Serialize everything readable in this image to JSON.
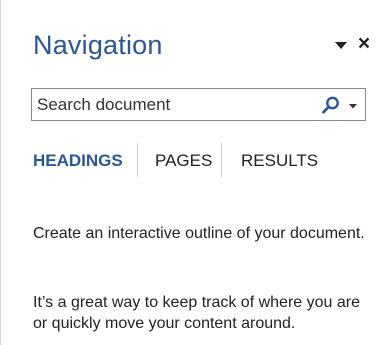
{
  "pane": {
    "title": "Navigation",
    "menu_icon": "caret-down-icon",
    "close_icon": "close-icon",
    "close_glyph": "×"
  },
  "search": {
    "placeholder": "Search document",
    "value": "",
    "search_icon": "magnifier-icon",
    "dropdown_icon": "caret-down-icon"
  },
  "tabs": [
    {
      "label": "HEADINGS",
      "active": true
    },
    {
      "label": "PAGES",
      "active": false
    },
    {
      "label": "RESULTS",
      "active": false
    }
  ],
  "content": {
    "line1": "Create an interactive outline of your document.",
    "line2": "It’s a great way to keep track of where you are or quickly move your content around."
  },
  "colors": {
    "accent": "#2b5797",
    "text": "#222222",
    "border": "#8a8a8a"
  }
}
